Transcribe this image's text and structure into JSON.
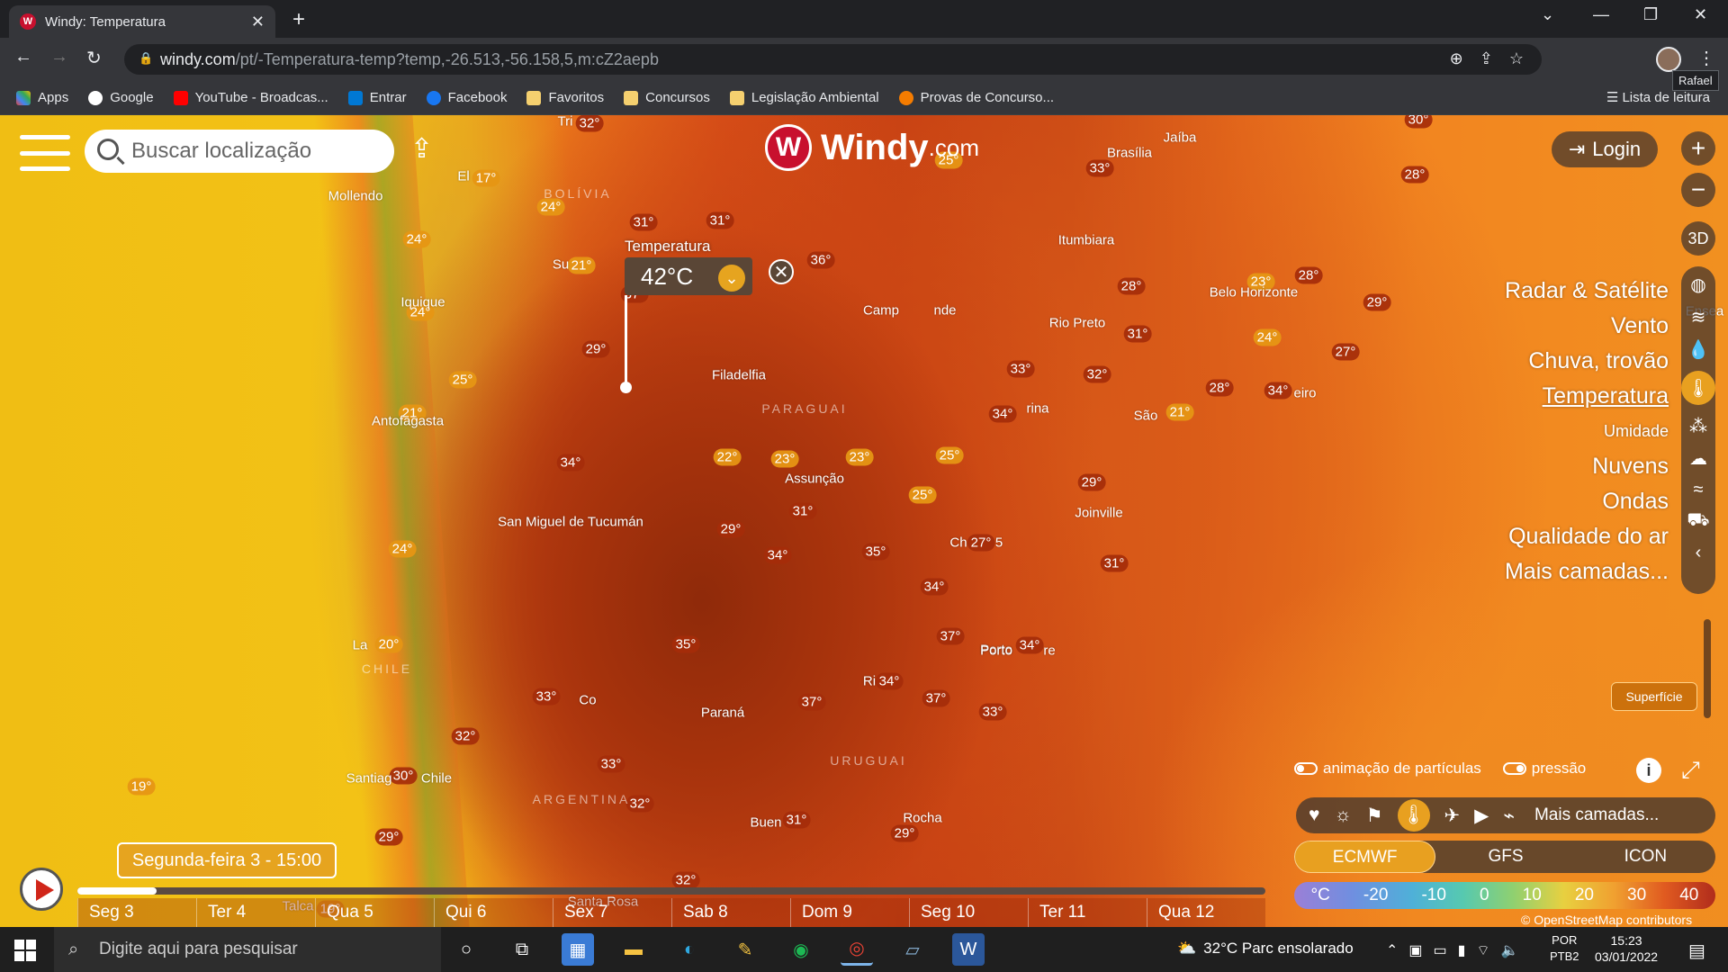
{
  "browser": {
    "tab_title": "Windy: Temperatura",
    "tab_favicon": "W",
    "url_domain": "windy.com",
    "url_path": "/pt/-Temperatura-temp?temp,-26.513,-56.158,5,m:cZ2aepb",
    "profile_tooltip": "Rafael",
    "bookmarks": [
      "Apps",
      "Google",
      "YouTube - Broadcas...",
      "Entrar",
      "Facebook",
      "Favoritos",
      "Concursos",
      "Legislação Ambiental",
      "Provas de Concurso..."
    ],
    "reading_list": "Lista de leitura"
  },
  "app": {
    "search_placeholder": "Buscar localização",
    "logo_main": "Windy",
    "logo_suffix": ".com",
    "login_label": "Login",
    "zoom_in": "+",
    "zoom_out": "−",
    "three_d": "3D",
    "picker": {
      "label": "Temperatura",
      "value": "42°C"
    },
    "layers": [
      "Radar & Satélite",
      "Vento",
      "Chuva, trovão",
      "Temperatura",
      "Umidade",
      "Nuvens",
      "Ondas",
      "Qualidade do ar",
      "Mais camadas..."
    ],
    "active_layer": "Temperatura",
    "superficie": "Superfície",
    "toggle_particles": "animação de partículas",
    "toggle_pressure": "pressão",
    "more_layers": "Mais camadas...",
    "models": [
      "ECMWF",
      "GFS",
      "ICON"
    ],
    "selected_model": "ECMWF",
    "legend": [
      "°C",
      "-20",
      "-10",
      "0",
      "10",
      "20",
      "30",
      "40"
    ],
    "attribution": "© OpenStreetMap contributors",
    "current_time": "Segunda-feira 3 - 15:00",
    "days": [
      "Seg 3",
      "Ter 4",
      "Qua 5",
      "Qui 6",
      "Sex 7",
      "Sab 8",
      "Dom 9",
      "Seg 10",
      "Ter 11",
      "Qua 12"
    ],
    "accent_color": "#e8a020"
  },
  "map": {
    "temps": [
      "32°",
      "17°",
      "24°",
      "24°",
      "24°",
      "21°",
      "31°",
      "31°",
      "36°",
      "37°",
      "29°",
      "25°",
      "21°",
      "34°",
      "22°",
      "23°",
      "23°",
      "25°",
      "25°",
      "31°",
      "29°",
      "34°",
      "35°",
      "24°",
      "27°",
      "34°",
      "20°",
      "37°",
      "35°",
      "33°",
      "37°",
      "34°",
      "37°",
      "33°",
      "32°",
      "33°",
      "30°",
      "32°",
      "31°",
      "29°",
      "32°",
      "19°",
      "19°",
      "29°",
      "25°",
      "33°",
      "28°",
      "31°",
      "23°",
      "28°",
      "24°",
      "33°",
      "32°",
      "34°",
      "21°",
      "28°",
      "34°",
      "27°",
      "29°",
      "29°",
      "31°",
      "34°",
      "30°",
      "28°"
    ],
    "cities": [
      "Mollendo",
      "El",
      "Iquique",
      "Antofagasta",
      "Su",
      "Filadelfia",
      "Assunção",
      "San Miguel de Tucumán",
      "La",
      "Co",
      "Paraná",
      "Santiag",
      "Chile",
      "Buen",
      "Santa Rosa",
      "Talca",
      "Ri",
      "Rocha",
      "Porto",
      "Brasília",
      "Jaíba",
      "Itumbiara",
      "Camp",
      "Rio Preto",
      "Belo Horizonte",
      "São",
      "Joinville",
      "Ch",
      "Porto",
      "Ensea",
      "Tri",
      "nde",
      "rina",
      "eiro",
      "5",
      "re"
    ],
    "countries": [
      "BOLÍVIA",
      "PARAGUAI",
      "CHILE",
      "ARGENTINA",
      "URUGUAI"
    ]
  },
  "taskbar": {
    "search_placeholder": "Digite aqui para pesquisar",
    "weather": "32°C  Parc ensolarado",
    "lang_1": "POR",
    "lang_2": "PTB2",
    "time": "15:23",
    "date": "03/01/2022"
  }
}
